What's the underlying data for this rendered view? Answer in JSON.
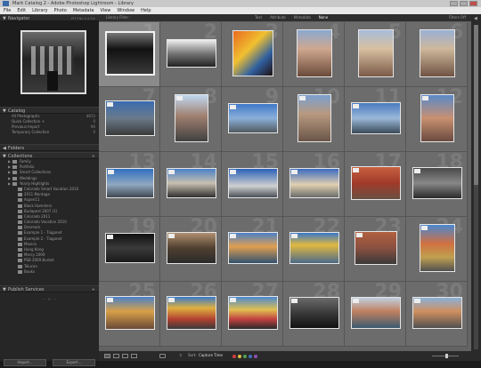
{
  "window": {
    "title": "Mark Catalog 2 - Adobe Photoshop Lightroom - Library"
  },
  "menu": [
    "File",
    "Edit",
    "Library",
    "Photo",
    "Metadata",
    "View",
    "Window",
    "Help"
  ],
  "left": {
    "navigator_title": "Navigator",
    "navigator_zoom": "FIT  FILL  1:1  3:1",
    "catalog_title": "Catalog",
    "catalog_items": [
      {
        "label": "All Photographs",
        "count": "4672"
      },
      {
        "label": "Quick Collection +",
        "count": "0"
      },
      {
        "label": "Previous Import",
        "count": "90"
      },
      {
        "label": "Temporary Collection",
        "count": "0"
      }
    ],
    "folders_title": "Folders",
    "collections_title": "Collections",
    "collections": [
      {
        "label": "Family",
        "sub": false
      },
      {
        "label": "Portfolio",
        "sub": false
      },
      {
        "label": "Smart Collections",
        "sub": false
      },
      {
        "label": "Weddings",
        "sub": false
      },
      {
        "label": "Yearly Highlights",
        "sub": false
      },
      {
        "label": "Colorado Smart Vacation 2010",
        "sub": true
      },
      {
        "label": "2011 Montage",
        "sub": true
      },
      {
        "label": "Aspen11",
        "sub": true
      },
      {
        "label": "Black Hamsters",
        "sub": true
      },
      {
        "label": "Budapest 2007 (1)",
        "sub": true
      },
      {
        "label": "Colorado 2011",
        "sub": true
      },
      {
        "label": "Colorado Vacation 2010",
        "sub": true
      },
      {
        "label": "Denmark",
        "sub": true
      },
      {
        "label": "Example 1 - Tiagonet",
        "sub": true
      },
      {
        "label": "Example 2 - Tiagonet",
        "sub": true
      },
      {
        "label": "Mexico",
        "sub": true
      },
      {
        "label": "Hong Kong",
        "sub": true
      },
      {
        "label": "Mercy 2009",
        "sub": true
      },
      {
        "label": "PSB 2009 Burket",
        "sub": true
      },
      {
        "label": "Tolucan",
        "sub": true
      },
      {
        "label": "Books",
        "sub": true
      }
    ],
    "publish_title": "Publish Services",
    "import_btn": "Import...",
    "export_btn": "Export..."
  },
  "filterbar": {
    "label": "Library Filter :",
    "tabs": [
      "Text",
      "Attribute",
      "Metadata",
      "None"
    ],
    "active_tab": "None",
    "right": "Filters Off"
  },
  "toolbar": {
    "sort_label": "Sort:",
    "sort_value": "Capture Time",
    "swatches": [
      "#d64040",
      "#e0c040",
      "#50a050",
      "#4070c0",
      "#9050b0"
    ]
  },
  "grid_numbers": [
    "1",
    "2",
    "3",
    "4",
    "5",
    "6",
    "7",
    "8",
    "9",
    "10",
    "11",
    "12",
    "13",
    "14",
    "15",
    "16",
    "17",
    "18",
    "19",
    "20",
    "21",
    "22",
    "23",
    "24",
    "25",
    "26",
    "27",
    "28",
    "29",
    "30"
  ]
}
